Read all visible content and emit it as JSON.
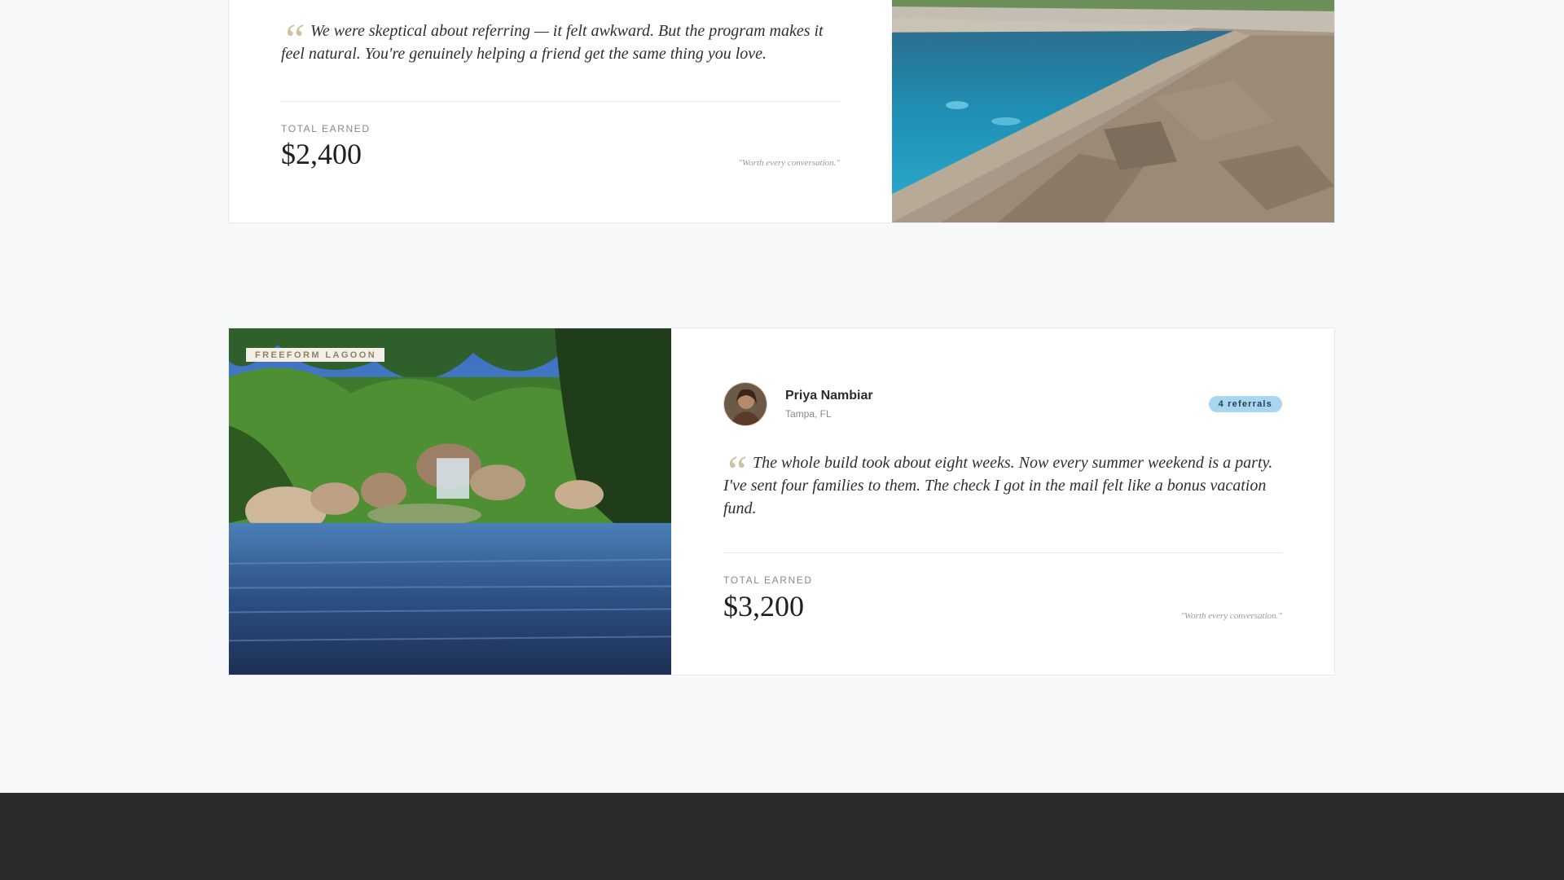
{
  "testimonials": [
    {
      "quote": "We were skeptical about referring — it felt awkward. But the program makes it feel natural. You're genuinely helping a friend get the same thing you love.",
      "earned_label": "TOTAL EARNED",
      "earned_value": "$2,400",
      "tagline": "\"Worth every conversation.\""
    },
    {
      "tag": "FREEFORM LAGOON",
      "name": "Priya Nambiar",
      "location": "Tampa, FL",
      "referrals": "4 referrals",
      "quote": "The whole build took about eight weeks. Now every summer weekend is a party. I've sent four families to them. The check I got in the mail felt like a bonus vacation fund.",
      "earned_label": "TOTAL EARNED",
      "earned_value": "$3,200",
      "tagline": "\"Worth every conversation.\""
    }
  ],
  "colors": {
    "background": "#f7f8fa",
    "badge": "#a7d7f0",
    "quote_mark": "#cfc1a4",
    "footer": "#2b2b2b"
  },
  "icons": [
    "quote-mark-icon"
  ]
}
